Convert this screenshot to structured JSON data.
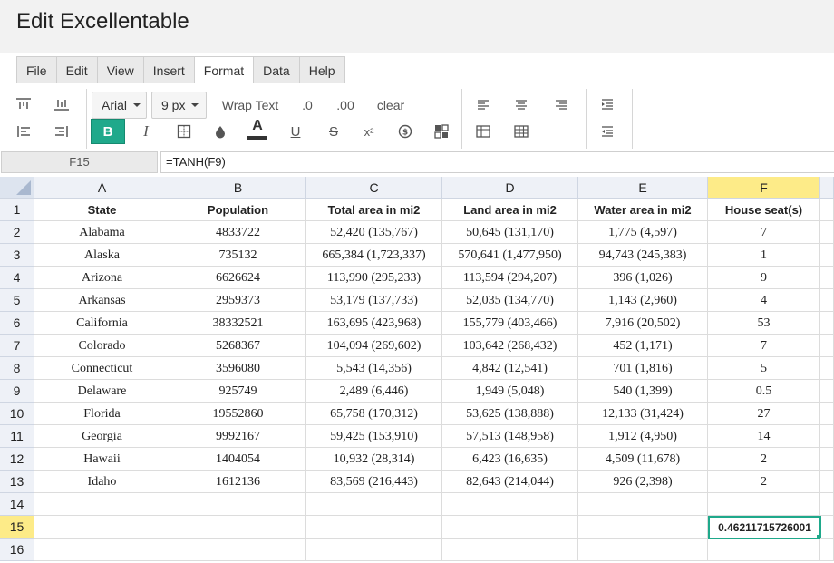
{
  "app": {
    "title": "Edit Excellentable"
  },
  "menu": [
    "File",
    "Edit",
    "View",
    "Insert",
    "Format",
    "Data",
    "Help"
  ],
  "menu_active": "Format",
  "toolbar": {
    "font_family": "Arial",
    "font_size": "9 px",
    "wrap_text": "Wrap Text",
    "dec_less": ".0",
    "dec_more": ".00",
    "clear": "clear",
    "bold": "B",
    "italic": "I",
    "underline": "U",
    "strike": "S",
    "superscript": "x²",
    "text_color_letter": "A",
    "text_color": "#333333",
    "accent": "#1fa98b"
  },
  "formula_bar": {
    "cell_ref": "F15",
    "formula": "=TANH(F9)"
  },
  "columns": [
    "A",
    "B",
    "C",
    "D",
    "E",
    "F"
  ],
  "selected_column": "F",
  "selected_row": "15",
  "rows": [
    {
      "num": "1",
      "cells": [
        "State",
        "Population",
        "Total area in mi2",
        "Land area in mi2",
        "Water area in mi2",
        "House seat(s)"
      ]
    },
    {
      "num": "2",
      "cells": [
        "Alabama",
        "4833722",
        "52,420 (135,767)",
        "50,645 (131,170)",
        "1,775 (4,597)",
        "7"
      ]
    },
    {
      "num": "3",
      "cells": [
        "Alaska",
        "735132",
        "665,384 (1,723,337)",
        "570,641 (1,477,950)",
        "94,743 (245,383)",
        "1"
      ]
    },
    {
      "num": "4",
      "cells": [
        "Arizona",
        "6626624",
        "113,990 (295,233)",
        "113,594 (294,207)",
        "396 (1,026)",
        "9"
      ]
    },
    {
      "num": "5",
      "cells": [
        "Arkansas",
        "2959373",
        "53,179 (137,733)",
        "52,035 (134,770)",
        "1,143 (2,960)",
        "4"
      ]
    },
    {
      "num": "6",
      "cells": [
        "California",
        "38332521",
        "163,695 (423,968)",
        "155,779 (403,466)",
        "7,916 (20,502)",
        "53"
      ]
    },
    {
      "num": "7",
      "cells": [
        "Colorado",
        "5268367",
        "104,094 (269,602)",
        "103,642 (268,432)",
        "452 (1,171)",
        "7"
      ]
    },
    {
      "num": "8",
      "cells": [
        "Connecticut",
        "3596080",
        "5,543 (14,356)",
        "4,842 (12,541)",
        "701 (1,816)",
        "5"
      ]
    },
    {
      "num": "9",
      "cells": [
        "Delaware",
        "925749",
        "2,489 (6,446)",
        "1,949 (5,048)",
        "540 (1,399)",
        "0.5"
      ]
    },
    {
      "num": "10",
      "cells": [
        "Florida",
        "19552860",
        "65,758 (170,312)",
        "53,625 (138,888)",
        "12,133 (31,424)",
        "27"
      ]
    },
    {
      "num": "11",
      "cells": [
        "Georgia",
        "9992167",
        "59,425 (153,910)",
        "57,513 (148,958)",
        "1,912 (4,950)",
        "14"
      ]
    },
    {
      "num": "12",
      "cells": [
        "Hawaii",
        "1404054",
        "10,932 (28,314)",
        "6,423 (16,635)",
        "4,509 (11,678)",
        "2"
      ]
    },
    {
      "num": "13",
      "cells": [
        "Idaho",
        "1612136",
        "83,569 (216,443)",
        "82,643 (214,044)",
        "926 (2,398)",
        "2"
      ]
    },
    {
      "num": "14",
      "cells": [
        "",
        "",
        "",
        "",
        "",
        ""
      ]
    },
    {
      "num": "15",
      "cells": [
        "",
        "",
        "",
        "",
        "",
        "0.46211715726001"
      ]
    },
    {
      "num": "16",
      "cells": [
        "",
        "",
        "",
        "",
        "",
        ""
      ]
    }
  ]
}
